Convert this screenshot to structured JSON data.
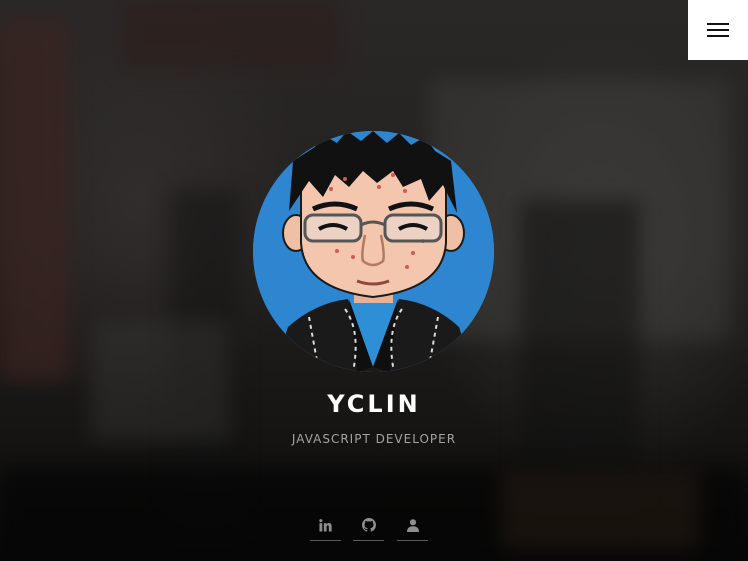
{
  "profile": {
    "name": "YCLIN",
    "role": "JAVASCRIPT DEVELOPER"
  },
  "menu": {
    "icon": "hamburger-menu-icon"
  },
  "social_links": [
    {
      "icon": "linkedin-icon"
    },
    {
      "icon": "github-icon"
    },
    {
      "icon": "user-icon"
    }
  ],
  "colors": {
    "avatar_background": "#2e86d0",
    "menu_button_background": "#ffffff",
    "name_text": "#ffffff",
    "role_text": "#a3a3a3",
    "social_icon": "#8e8e8e"
  }
}
